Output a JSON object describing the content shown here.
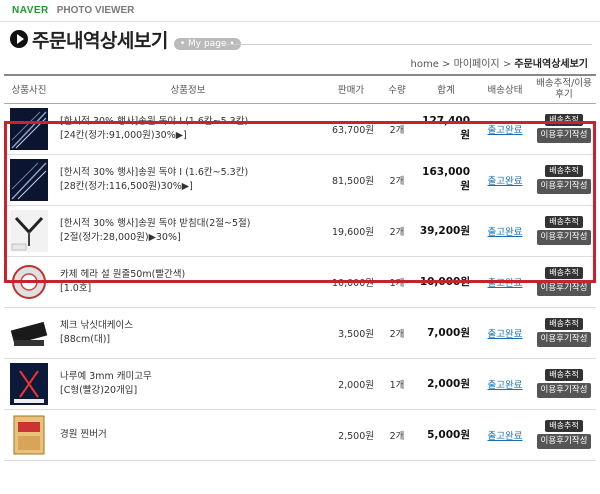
{
  "topbar": {
    "brand": "NAVER",
    "viewer": "PHOTO VIEWER"
  },
  "header": {
    "title": "주문내역상세보기",
    "badge": "My page"
  },
  "breadcrumb": {
    "home": "home",
    "sep1": ">",
    "mypage": "마이페이지",
    "sep2": ">",
    "current": "주문내역상세보기"
  },
  "table": {
    "columns": [
      "상품사진",
      "상품정보",
      "판매가",
      "수량",
      "합계",
      "배송상태",
      "배송추적/이용후기"
    ],
    "track_label": "배송추적",
    "review_label": "이용후기작성",
    "rows": [
      {
        "line1": "[한시적 30% 행사]송원 독야 I (1.6칸~5.3칸)",
        "line2": "[24칸(정가:91,000원)30%▶]",
        "price": "63,700원",
        "qty": "2개",
        "total": "127,400원",
        "status": "출고완료"
      },
      {
        "line1": "[한시적 30% 행사]송원 독야 I (1.6칸~5.3칸)",
        "line2": "[28칸(정가:116,500원)30%▶]",
        "price": "81,500원",
        "qty": "2개",
        "total": "163,000원",
        "status": "출고완료"
      },
      {
        "line1": "[한시적 30% 행사]송원 독야 받침대(2절~5절)",
        "line2": "[2절(정가:28,000원)▶30%]",
        "price": "19,600원",
        "qty": "2개",
        "total": "39,200원",
        "status": "출고완료"
      },
      {
        "line1": "카제 헤라 설 원줄50m(빨간색)",
        "line2": "[1.0호]",
        "price": "10,000원",
        "qty": "1개",
        "total": "10,000원",
        "status": "출고완료"
      },
      {
        "line1": "체크 낚싯대케이스",
        "line2": "[88cm(대)]",
        "price": "3,500원",
        "qty": "2개",
        "total": "7,000원",
        "status": "출고완료"
      },
      {
        "line1": "나루예 3mm 캐미고무",
        "line2": "[C형(빨강)20개입]",
        "price": "2,000원",
        "qty": "1개",
        "total": "2,000원",
        "status": "출고완료"
      },
      {
        "line1": "경원 찐버거",
        "line2": "",
        "price": "2,500원",
        "qty": "2개",
        "total": "5,000원",
        "status": "출고완료"
      }
    ]
  },
  "colors": {
    "highlight": "#c8222c",
    "status_link": "#1a6fb0",
    "brand": "#1a9b2b"
  }
}
